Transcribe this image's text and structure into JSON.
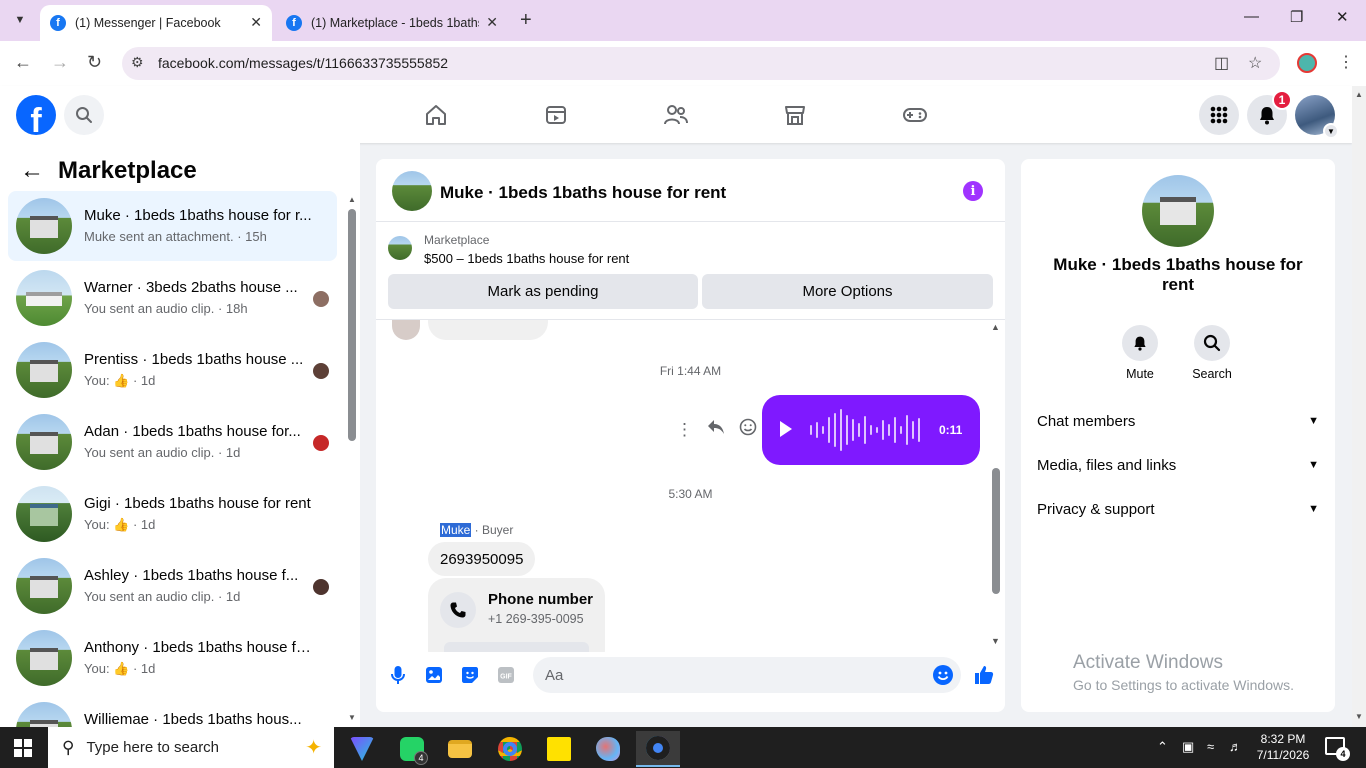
{
  "browser": {
    "tabs": [
      {
        "title": "(1) Messenger | Facebook",
        "active": true
      },
      {
        "title": "(1) Marketplace - 1beds 1baths",
        "active": false
      }
    ],
    "url": "facebook.com/messages/t/1166633735555852"
  },
  "fb_header": {
    "logo_letter": "f",
    "notification_count": "1"
  },
  "left_panel": {
    "title": "Marketplace",
    "conversations": [
      {
        "name": "Muke · 1beds 1baths house for r...",
        "preview": "Muke sent an attachment. · 15h",
        "active": true
      },
      {
        "name": "Warner · 3beds 2baths house ...",
        "preview": "You sent an audio clip. · 18h"
      },
      {
        "name": "Prentiss · 1beds 1baths house ...",
        "preview_prefix": "You: ",
        "preview_suffix": " · 1d"
      },
      {
        "name": "Adan · 1beds 1baths house for...",
        "preview": "You sent an audio clip. · 1d"
      },
      {
        "name": "Gigi · 1beds 1baths house for rent",
        "preview_prefix": "You: ",
        "preview_suffix": " · 1d"
      },
      {
        "name": "Ashley · 1beds 1baths house f...",
        "preview": "You sent an audio clip. · 1d"
      },
      {
        "name": "Anthony · 1beds 1baths house fo...",
        "preview_prefix": "You: ",
        "preview_suffix": " · 1d"
      },
      {
        "name": "Williemae · 1beds 1baths hous...",
        "preview": ""
      }
    ]
  },
  "chat": {
    "title": "Muke · 1beds 1baths house for rent",
    "marketplace_label": "Marketplace",
    "listing": "$500 – 1beds 1baths house for rent",
    "mark_pending_label": "Mark as pending",
    "more_options_label": "More Options",
    "timestamp_1": "Fri 1:44 AM",
    "audio_duration": "0:11",
    "timestamp_2": "5:30 AM",
    "sender_name": "Muke",
    "sender_role": " · Buyer",
    "phone_message": "2693950095",
    "phone_card_title": "Phone number",
    "phone_card_value": "+1 269-395-0095",
    "composer_placeholder": "Aa"
  },
  "right_panel": {
    "name": "Muke · 1beds 1baths house for rent",
    "mute_label": "Mute",
    "search_label": "Search",
    "sections": [
      "Chat members",
      "Media, files and links",
      "Privacy & support"
    ]
  },
  "watermark": {
    "line1": "Activate Windows",
    "line2": "Go to Settings to activate Windows."
  },
  "taskbar": {
    "search_placeholder": "Type here to search",
    "whatsapp_badge": "4",
    "time": "8:32 PM",
    "date": "7/11/2026",
    "notification_count": "4"
  },
  "colors": {
    "fb_blue": "#0866ff",
    "messenger_purple": "#7f19ff",
    "active_row": "#ebf5ff"
  }
}
